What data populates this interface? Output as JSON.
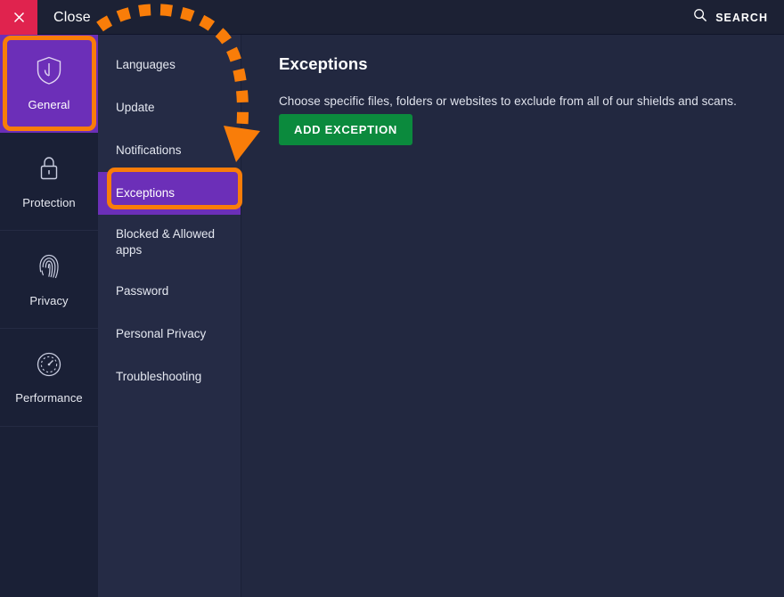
{
  "window": {
    "close_button_label": "Close",
    "close_icon": "close-x-icon",
    "search_label": "SEARCH",
    "search_icon": "magnifier-icon"
  },
  "colors": {
    "accent_purple": "#6c2fb8",
    "annotation_orange": "#f97d09",
    "close_red": "#e0234e",
    "button_green": "#0b8a3d",
    "panel_dark": "#1a2036",
    "panel_mid": "#252b45",
    "content_bg": "#222840",
    "header_bg": "#1c2134"
  },
  "rail": {
    "items": [
      {
        "label": "General",
        "icon": "shield-icon",
        "active": true
      },
      {
        "label": "Protection",
        "icon": "lock-icon",
        "active": false
      },
      {
        "label": "Privacy",
        "icon": "fingerprint-icon",
        "active": false
      },
      {
        "label": "Performance",
        "icon": "speedometer-icon",
        "active": false
      }
    ]
  },
  "menu": {
    "items": [
      {
        "label": "Languages",
        "selected": false
      },
      {
        "label": "Update",
        "selected": false
      },
      {
        "label": "Notifications",
        "selected": false
      },
      {
        "label": "Exceptions",
        "selected": true
      },
      {
        "label": "Blocked & Allowed apps",
        "selected": false
      },
      {
        "label": "Password",
        "selected": false
      },
      {
        "label": "Personal Privacy",
        "selected": false
      },
      {
        "label": "Troubleshooting",
        "selected": false
      }
    ]
  },
  "content": {
    "title": "Exceptions",
    "description": "Choose specific files, folders or websites to exclude from all of our shields and scans.",
    "add_button_label": "ADD EXCEPTION"
  },
  "annotations": {
    "highlight_general": "General",
    "highlight_exceptions": "Exceptions",
    "arrow": "curved-dashed-arrow"
  }
}
